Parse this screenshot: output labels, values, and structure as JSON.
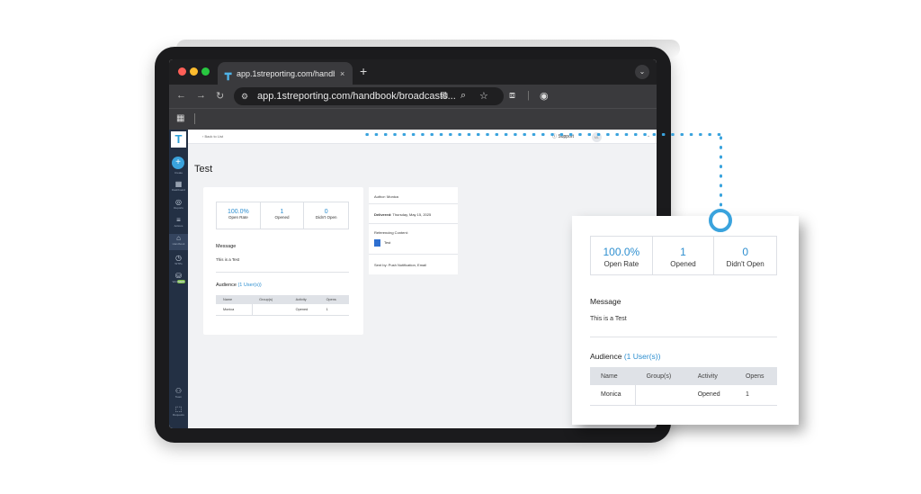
{
  "browser": {
    "tab_title": "app.1streporting.com/handbo",
    "tab_close": "×",
    "new_tab": "+",
    "url": "app.1streporting.com/handbook/broadcasts...",
    "tab_menu": "⌄"
  },
  "app": {
    "logo": "T",
    "back_link": "‹ Back to List",
    "support": "Support",
    "avatar_initials": "ML",
    "page_title": "Test",
    "sidebar": [
      {
        "icon": "+",
        "label": "Create"
      },
      {
        "icon": "▦",
        "label": "Dashboard"
      },
      {
        "icon": "◎",
        "label": "Reports"
      },
      {
        "icon": "≡",
        "label": "Actions"
      },
      {
        "icon": "⌂",
        "label": "Handbook"
      },
      {
        "icon": "◷",
        "label": "WTPs"
      },
      {
        "icon": "⛁",
        "label": "Workflows"
      },
      {
        "icon": "⚇",
        "label": "Team"
      },
      {
        "icon": "⬚",
        "label": "Requests"
      }
    ],
    "new_badge": "NEW"
  },
  "stats": [
    {
      "value": "100.0%",
      "label": "Open Rate"
    },
    {
      "value": "1",
      "label": "Opened"
    },
    {
      "value": "0",
      "label": "Didn't Open"
    }
  ],
  "message": {
    "heading": "Message",
    "text": "This is a Test"
  },
  "audience": {
    "heading": "Audience",
    "link": "(1 User(s))",
    "columns": [
      "Name",
      "Group(s)",
      "Activity",
      "Opens"
    ],
    "rows": [
      {
        "name": "Monica",
        "groups": "",
        "activity": "Opened",
        "opens": "1"
      }
    ]
  },
  "info": {
    "author": "Author: Monica",
    "delivered_label": "Delivered:",
    "delivered_value": "Thursday, May 15, 2025",
    "referencing_label": "Referencing Content:",
    "referencing_doc": "Test",
    "sent_by": "Sent by: Push Notification, Email"
  },
  "colors": {
    "accent": "#3aa3dd",
    "sidebar": "#233044",
    "stat_value": "#2e8fd0"
  }
}
